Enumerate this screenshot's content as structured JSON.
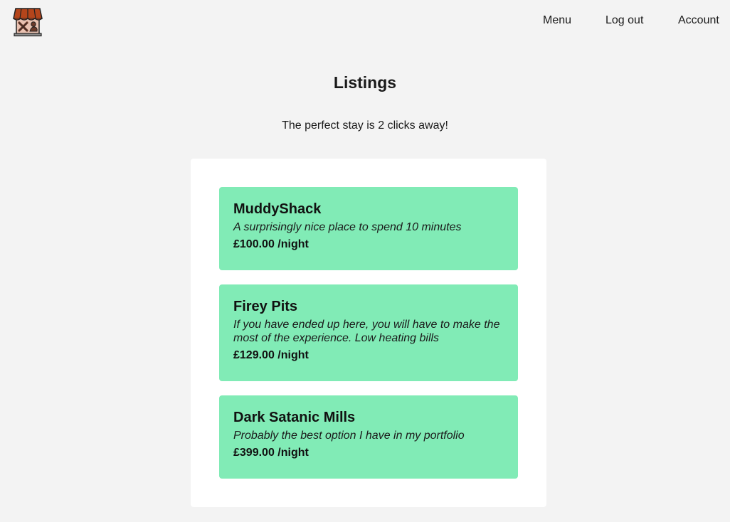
{
  "header": {
    "logo_icon": "shop-icon",
    "nav": [
      {
        "label": "Menu"
      },
      {
        "label": "Log out"
      },
      {
        "label": "Account"
      }
    ]
  },
  "main": {
    "title": "Listings",
    "subtitle": "The perfect stay is 2 clicks away!",
    "listings": [
      {
        "name": "MuddyShack",
        "description": "A surprisingly nice place to spend 10 minutes",
        "price": "£100.00 /night"
      },
      {
        "name": "Firey Pits",
        "description": "If you have ended up here, you will have to make the most of the experience. Low heating bills",
        "price": "£129.00 /night"
      },
      {
        "name": "Dark Satanic Mills",
        "description": "Probably the best option I have in my portfolio",
        "price": "£399.00 /night"
      }
    ]
  },
  "colors": {
    "background": "#f3f3f3",
    "panel": "#ffffff",
    "card": "#81ebb6",
    "roof": "#b5451b",
    "wall": "#e9c2b2"
  }
}
